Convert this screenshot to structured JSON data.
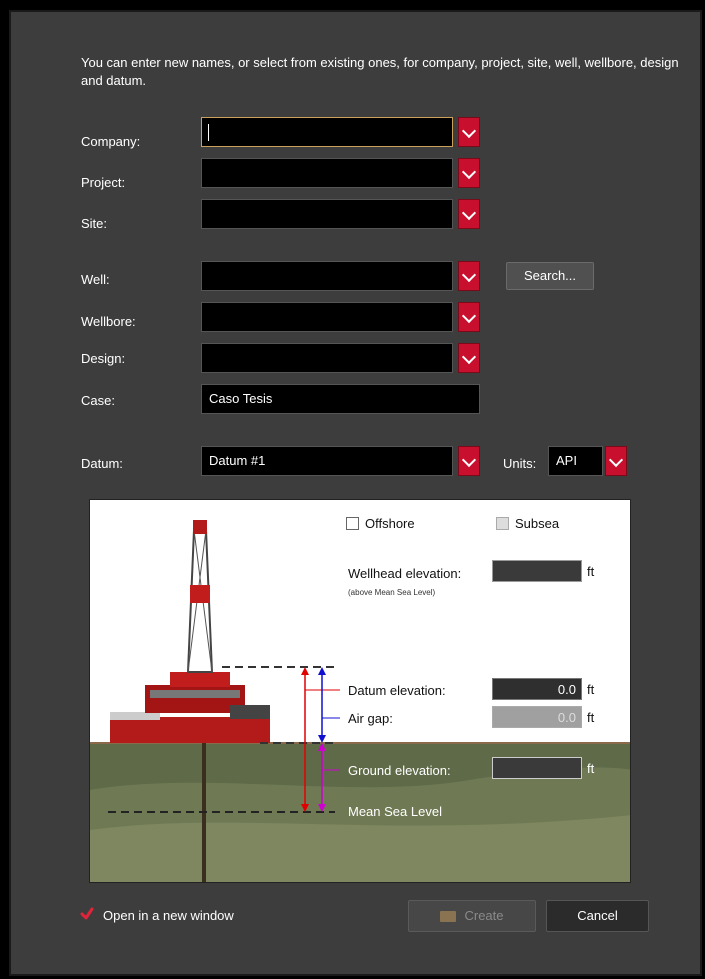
{
  "intro": "You can enter new names, or select from existing ones, for company, project, site, well, wellbore, design and datum.",
  "labels": {
    "company": "Company:",
    "project": "Project:",
    "site": "Site:",
    "well": "Well:",
    "wellbore": "Wellbore:",
    "design": "Design:",
    "case": "Case:",
    "datum": "Datum:",
    "units": "Units:"
  },
  "values": {
    "company": "",
    "project": "",
    "site": "",
    "well": "",
    "wellbore": "",
    "design": "",
    "case": "Caso Tesis",
    "datum": "Datum #1",
    "units": "API"
  },
  "buttons": {
    "search": "Search...",
    "create": "Create",
    "cancel": "Cancel"
  },
  "diagram": {
    "offshore": "Offshore",
    "subsea": "Subsea",
    "wellhead_elevation": "Wellhead elevation:",
    "wellhead_note": "(above Mean Sea Level)",
    "wellhead_value": "",
    "datum_elevation": "Datum elevation:",
    "datum_value": "0.0",
    "air_gap": "Air gap:",
    "air_gap_value": "0.0",
    "ground_elevation": "Ground elevation:",
    "ground_value": "",
    "mean_sea_level": "Mean Sea Level",
    "unit": "ft",
    "offshore_checked": false,
    "subsea_checked": false
  },
  "footer": {
    "open_new_window": "Open in a new window",
    "open_new_window_checked": true
  },
  "colors": {
    "accent_red": "#c8102e",
    "dialog_bg": "#3d3d3d",
    "datum_arrow": "#e00000",
    "air_gap_arrow": "#1010d0",
    "ground_arrow": "#d000d0"
  }
}
